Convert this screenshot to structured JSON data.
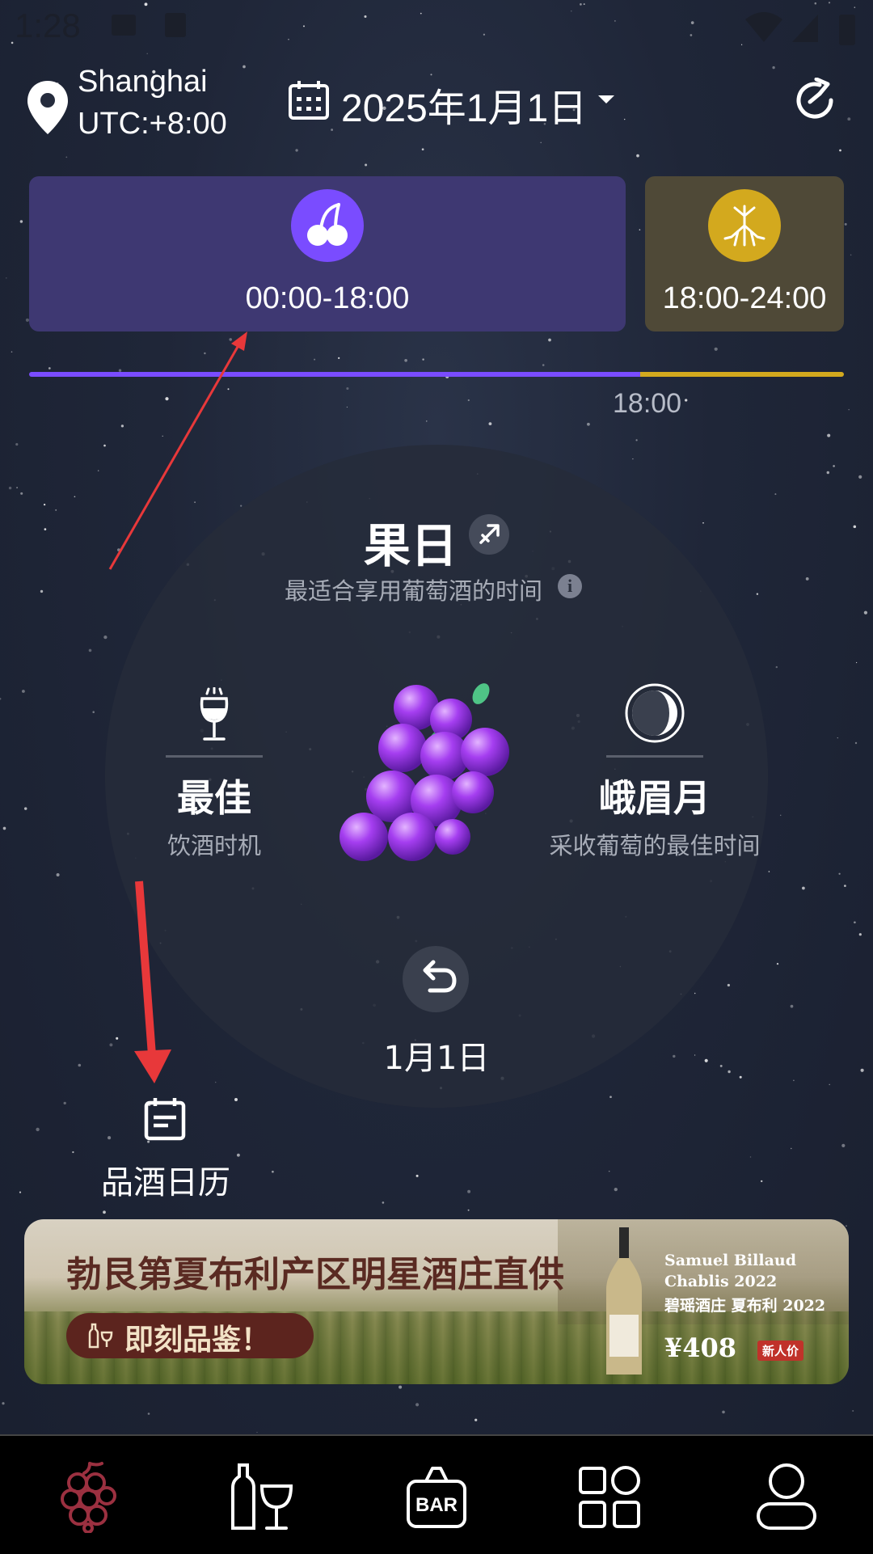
{
  "status_bar": {
    "time": "1:28"
  },
  "header": {
    "city": "Shanghai",
    "utc": "UTC:+8:00",
    "date": "2025年1月1日"
  },
  "periods": [
    {
      "type": "fruit",
      "icon": "cherry-icon",
      "time": "00:00-18:00",
      "color": "#7a4cff"
    },
    {
      "type": "root",
      "icon": "root-icon",
      "time": "18:00-24:00",
      "color": "#d3a91e"
    }
  ],
  "timeline": {
    "marker_label": "18:00",
    "fruit_fraction": 0.75
  },
  "day_info": {
    "title": "果日",
    "subtitle": "最适合享用葡萄酒的时间",
    "left": {
      "title": "最佳",
      "subtitle": "饮酒时机"
    },
    "right": {
      "title": "峨眉月",
      "subtitle": "采收葡萄的最佳时间"
    },
    "back_date": "1月1日"
  },
  "tasting_calendar": {
    "label": "品酒日历"
  },
  "banner": {
    "headline": "勃艮第夏布利产区明星酒庄直供",
    "cta": "即刻品鉴！",
    "wine_name_1": "Samuel Billaud",
    "wine_name_2": "Chablis 2022",
    "wine_name_3": "碧瑶酒庄 夏布利 2022",
    "price": "¥408",
    "price_badge": "新人价"
  },
  "nav": {
    "items": [
      "grapes-icon",
      "wine-bottle-glass-icon",
      "bar-bag-icon",
      "apps-grid-icon",
      "user-icon"
    ],
    "bar_label": "BAR",
    "active_color": "#9b3040"
  }
}
